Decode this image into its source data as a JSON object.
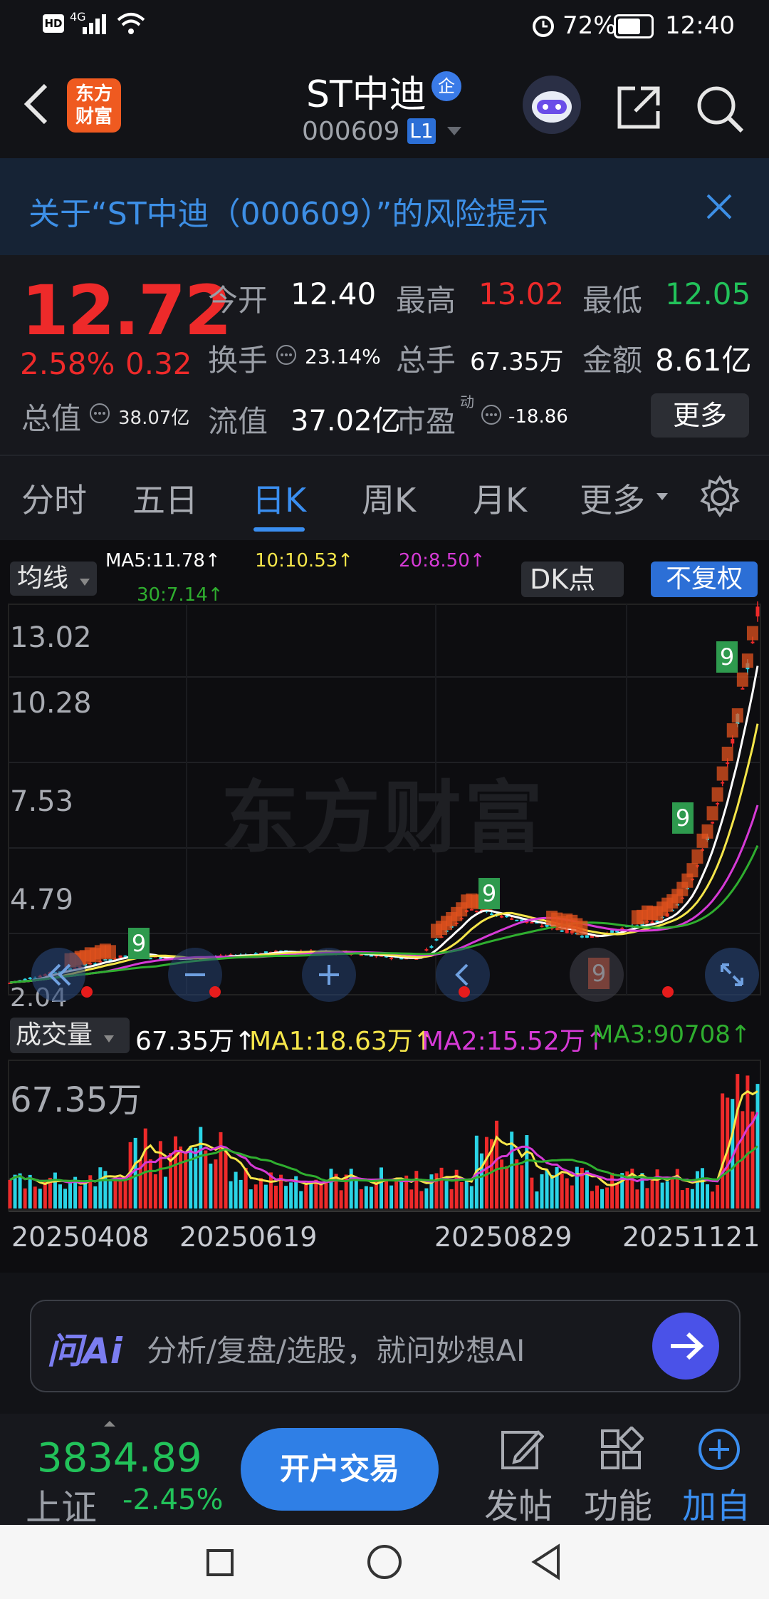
{
  "status": {
    "hd": "HD",
    "net": "4G",
    "battery": "72%",
    "time": "12:40"
  },
  "header": {
    "logo_line1": "东方",
    "logo_line2": "财富",
    "name": "ST中迪",
    "enterprise_badge": "企",
    "code": "000609",
    "level": "L1"
  },
  "risk": {
    "text": "关于“ST中迪（000609）”的风险提示"
  },
  "quote": {
    "price": "12.72",
    "change_pct": "2.58%",
    "change": "0.32",
    "open_label": "今开",
    "open": "12.40",
    "high_label": "最高",
    "high": "13.02",
    "low_label": "最低",
    "low": "12.05",
    "turnover_label": "换手",
    "turnover": "23.14%",
    "volume_label": "总手",
    "volume": "67.35万",
    "amount_label": "金额",
    "amount": "8.61亿",
    "mktcap_label": "总值",
    "mktcap": "38.07亿",
    "float_label": "流值",
    "float": "37.02亿",
    "pe_label": "市盈",
    "pe_sup": "动",
    "pe": "-18.86",
    "more": "更多"
  },
  "tabs": {
    "t1": "分时",
    "t2": "五日",
    "t3": "日K",
    "t4": "周K",
    "t5": "月K",
    "t6": "更多"
  },
  "ma": {
    "button": "均线",
    "ma5": "MA5:11.78↑",
    "ma10": "10:10.53↑",
    "ma20": "20:8.50↑",
    "ma30": "30:7.14↑",
    "dk": "DK点",
    "adjust": "不复权"
  },
  "price_axis": {
    "p1": "13.02",
    "p2": "10.28",
    "p3": "7.53",
    "p4": "4.79",
    "p5": "2.04"
  },
  "watermark": "东方财富",
  "signals": {
    "nine": "9"
  },
  "volume": {
    "button": "成交量",
    "val": "67.35万↑",
    "ma1": "MA1:18.63万↑",
    "ma2": "MA2:15.52万↑",
    "ma3": "MA3:90708↑",
    "axis_top": "67.35万"
  },
  "dates": {
    "d1": "20250408",
    "d2": "20250619",
    "d3": "20250829",
    "d4": "20251121"
  },
  "ai": {
    "logo": "问Ai",
    "placeholder": "分析/复盘/选股，就问妙想AI"
  },
  "bottom": {
    "index_value": "3834.89",
    "index_name": "上证",
    "index_change": "-2.45%",
    "trade": "开户交易",
    "post": "发帖",
    "func": "功能",
    "add": "加自"
  },
  "colors": {
    "up": "#ee2a2a",
    "down": "#22c25a",
    "accent": "#3a8ef0",
    "ma5": "#ffffff",
    "ma10": "#f5e64a",
    "ma20": "#d63ad6",
    "ma30": "#2fae2f"
  },
  "chart_data": {
    "type": "candlestick",
    "title": "",
    "ylim": [
      2.04,
      13.02
    ],
    "x_ticks": [
      "20250408",
      "20250619",
      "20250829",
      "20251121"
    ],
    "last_close": 12.72,
    "ma": {
      "MA5": 11.78,
      "MA10": 10.53,
      "MA20": 8.5,
      "MA30": 7.14
    },
    "volume_max": "67.35万",
    "volume_ma": {
      "MA1": "18.63万",
      "MA2": "15.52万",
      "MA3": "90708"
    }
  }
}
